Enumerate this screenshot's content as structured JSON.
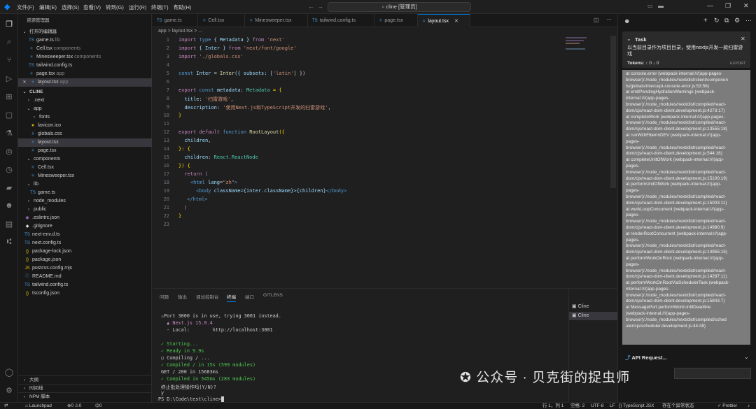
{
  "window": {
    "title": "cline [管理员]",
    "menu": [
      "文件(F)",
      "编辑(E)",
      "选择(S)",
      "查看(V)",
      "转到(G)",
      "运行(R)",
      "终端(T)",
      "帮助(H)"
    ]
  },
  "sidebar": {
    "title": "资源管理器",
    "open_editors_title": "打开的编辑器",
    "open_editors": [
      {
        "name": "game.ts",
        "desc": "lib"
      },
      {
        "name": "Cell.tsx",
        "desc": "components"
      },
      {
        "name": "Minesweeper.tsx",
        "desc": "components"
      },
      {
        "name": "tailwind.config.ts",
        "desc": ""
      },
      {
        "name": "page.tsx",
        "desc": "app"
      },
      {
        "name": "layout.tsx",
        "desc": "app"
      }
    ],
    "project": "CLINE",
    "tree": [
      ".next",
      "app",
      "fonts",
      "favicon.ico",
      "globals.css",
      "layout.tsx",
      "page.tsx",
      "components",
      "Cell.tsx",
      "Minesweeper.tsx",
      "lib",
      "game.ts",
      "node_modules",
      "public",
      ".eslintrc.json",
      ".gitignore",
      "next-env.d.ts",
      "next.config.ts",
      "package-lock.json",
      "package.json",
      "postcss.config.mjs",
      "README.md",
      "tailwind.config.ts",
      "tsconfig.json"
    ],
    "bottom": [
      "大纲",
      "时间线",
      "NPM 脚本"
    ]
  },
  "tabs": [
    "game.ts",
    "Cell.tsx",
    "Minesweeper.tsx",
    "tailwind.config.ts",
    "page.tsx",
    "layout.tsx"
  ],
  "breadcrumb": "app  >  layout.tsx  >  ...",
  "editor": {
    "line_numbers": [
      "1",
      "2",
      "3",
      "4",
      "5",
      "6",
      "7",
      "8",
      "9",
      "10",
      "11",
      "12",
      "13",
      "14",
      "15",
      "16",
      "17",
      "18",
      "19",
      "20",
      "21",
      "22",
      "23"
    ],
    "l1": [
      "import",
      "type",
      "{ Metadata }",
      "from",
      "'next'"
    ],
    "l2": [
      "import",
      "{ Inter }",
      "from",
      "'next/font/google'"
    ],
    "l3": [
      "import",
      "'./globals.css'"
    ],
    "l5": [
      "const",
      "Inter",
      "=",
      "Inter",
      "({ subsets: [",
      "'latin'",
      "] })"
    ],
    "l7": [
      "export",
      "const",
      "metadata",
      ": ",
      "Metadata",
      " = {"
    ],
    "l8": [
      "title",
      ": ",
      "'扫雷游戏'",
      ","
    ],
    "l9": [
      "description",
      ": ",
      "'使用Next.js和TypeScript开发的扫雷游戏'",
      ","
    ],
    "l10": "}",
    "l12": [
      "export",
      "default",
      "function",
      "RootLayout",
      "({"
    ],
    "l13": [
      "children",
      ","
    ],
    "l14": "}: {",
    "l15": [
      "children",
      ": ",
      "React.ReactNode"
    ],
    "l16": "}) {",
    "l17": [
      "return",
      "("
    ],
    "l18": [
      "<html",
      "lang",
      "=",
      "\"zh\"",
      ">"
    ],
    "l19": [
      "<body",
      "className",
      "={inter.className}>{children}",
      "</body>"
    ],
    "l20": "</html>",
    "l21": ")",
    "l22": "}"
  },
  "panel": {
    "tabs": [
      "问题",
      "输出",
      "调试控制台",
      "终端",
      "端口",
      "GITLENS"
    ],
    "lines": [
      "⚠Port 3000 is in use, trying 3001 instead.",
      "  ▲ Next.js 15.0.4",
      "  - Local:        http://localhost:3001",
      "",
      "✓ Starting...",
      "✓ Ready in 9.9s",
      "○ Compiling / ...",
      "✓ Compiled / in 15s (599 modules)",
      "GET / 200 in 15683ms",
      "✓ Compiled in 545ms (283 modules)",
      "终止批处理操作吗(Y/N)?",
      "y",
      "PS D:\\Code\\test\\cline>"
    ],
    "terminals": [
      "Cline",
      "Cline"
    ]
  },
  "cline": {
    "task_label": "Task",
    "task_text": "以当前目录作为项目目录，使用nextjs开发一款扫雷游戏",
    "tokens_label": "Tokens:",
    "tokens_up": "↑ 0",
    "tokens_down": "↓ 0",
    "export": "EXPORT",
    "error": "at console.error (webpack-internal:///(app-pages-\nbrowser)/./node_modules/next/dist/client/componen\nts/globals/intercept-console-error.js:53:56)\nat emitPendingHydrationWarnings (webpack-\ninternal:///(app-pages-\nbrowser)/./node_modules/next/dist/compiled/react-\ndom/cjs/react-dom-client.development.js:4273:17)\nat completeWork (webpack-internal:///(app-pages-\nbrowser)/./node_modules/next/dist/compiled/react-\ndom/cjs/react-dom-client.development.js:13555:18)\nat runWithFiberInDEV (webpack-internal:///(app-\npages-\nbrowser)/./node_modules/next/dist/compiled/react-\ndom/cjs/react-dom-client.development.js:544:16)\nat completeUnitOfWork (webpack-internal:///(app-\npages-\nbrowser)/./node_modules/next/dist/compiled/react-\ndom/cjs/react-dom-client.development.js:15100:19)\nat performUnitOfWork (webpack-internal:///(app-\npages-\nbrowser)/./node_modules/next/dist/compiled/react-\ndom/cjs/react-dom-client.development.js:15003:11)\nat workLoopConcurrent (webpack-internal:///(app-\npages-\nbrowser)/./node_modules/next/dist/compiled/react-\ndom/cjs/react-dom-client.development.js:14980:9)\nat renderRootConcurrent (webpack-internal:///(app-\npages-\nbrowser)/./node_modules/next/dist/compiled/react-\ndom/cjs/react-dom-client.development.js:14955:15)\nat performWorkOnRoot (webpack-internal:///(app-\npages-\nbrowser)/./node_modules/next/dist/compiled/react-\ndom/cjs/react-dom-client.development.js:14287:11)\nat performWorkOnRootViaSchedulerTask (webpack-\ninternal:///(app-pages-\nbrowser)/./node_modules/next/dist/compiled/react-\ndom/cjs/react-dom-client.development.js:15843:7)\nat MessagePort.performWorkUntilDeadline\n(webpack-internal:///(app-pages-\nbrowser)/./node_modules/next/dist/compiled/sched\nuler/cjs/scheduler.development.js:44:48)",
    "api_request": "API Request...",
    "watermark": "公众号 · 贝克街的捉虫师"
  },
  "status": {
    "launchpad": "Launchpad",
    "errors": "0",
    "warnings": "0",
    "ports": "0",
    "position": "行 1，列 1",
    "spaces": "空格: 2",
    "encoding": "UTF-8",
    "eol": "LF",
    "language": "TypeScript JSX",
    "chat": "存在个异常状态",
    "prettier": "Prettier"
  }
}
